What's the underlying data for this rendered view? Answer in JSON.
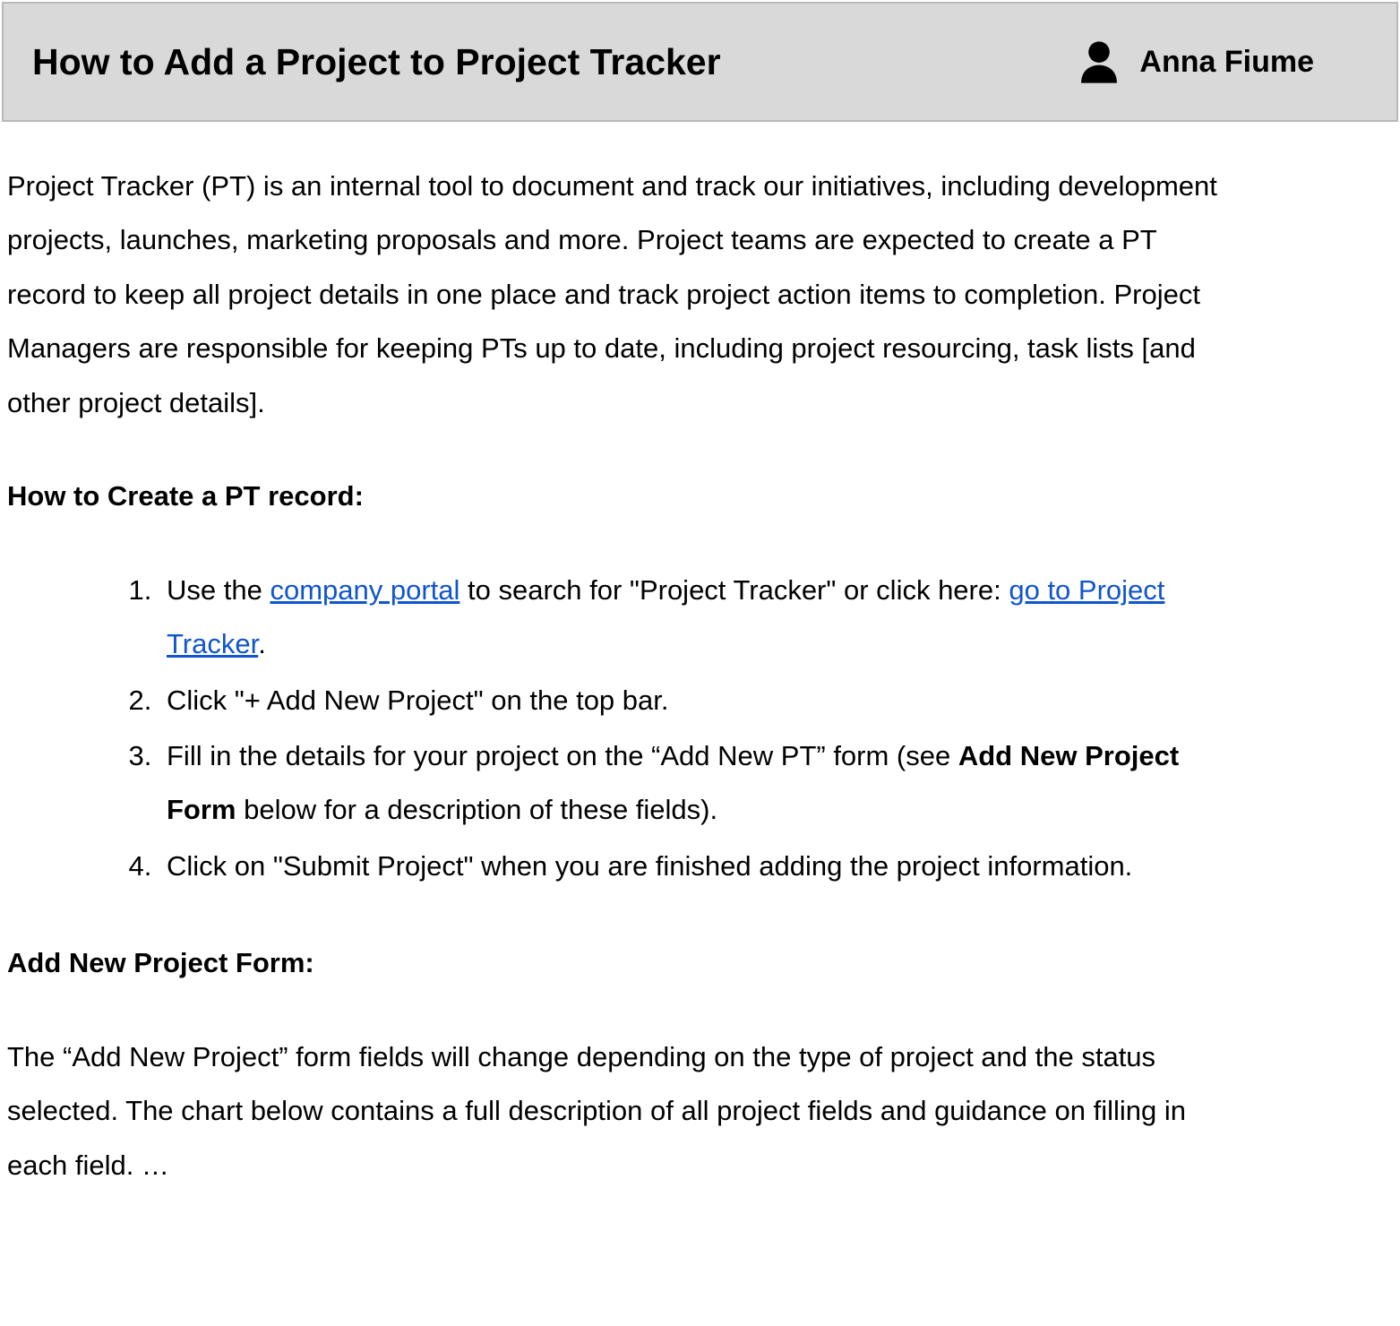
{
  "header": {
    "title": "How to Add a Project to Project Tracker",
    "author": "Anna Fiume"
  },
  "intro": "Project Tracker (PT) is an internal tool to document and track our initiatives, including development projects, launches, marketing proposals and more. Project teams are expected to create a PT record to keep all project details in one place and track project action items to completion. Project Managers are responsible for keeping PTs up to date, including project resourcing, task lists [and other project details].",
  "section_create_heading": "How to Create a PT record:",
  "steps": {
    "s1": {
      "pre": "Use the ",
      "link1": "company portal",
      "mid": " to search for \"Project Tracker\" or click here: ",
      "link2": "go to Project Tracker",
      "post": "."
    },
    "s2": "Click \"+ Add New Project\" on the top bar.",
    "s3": {
      "pre": "Fill in the details for your project on the “Add New PT” form (see ",
      "bold": "Add New Project Form",
      "post": " below for a description of these fields)."
    },
    "s4": "Click on \"Submit Project\" when you are finished adding the project information."
  },
  "section_form_heading": "Add New Project Form:",
  "form_intro": "The “Add New Project” form fields will change depending on the type of project and the status selected. The chart below contains a full description of all project fields and guidance on filling in each field. …"
}
